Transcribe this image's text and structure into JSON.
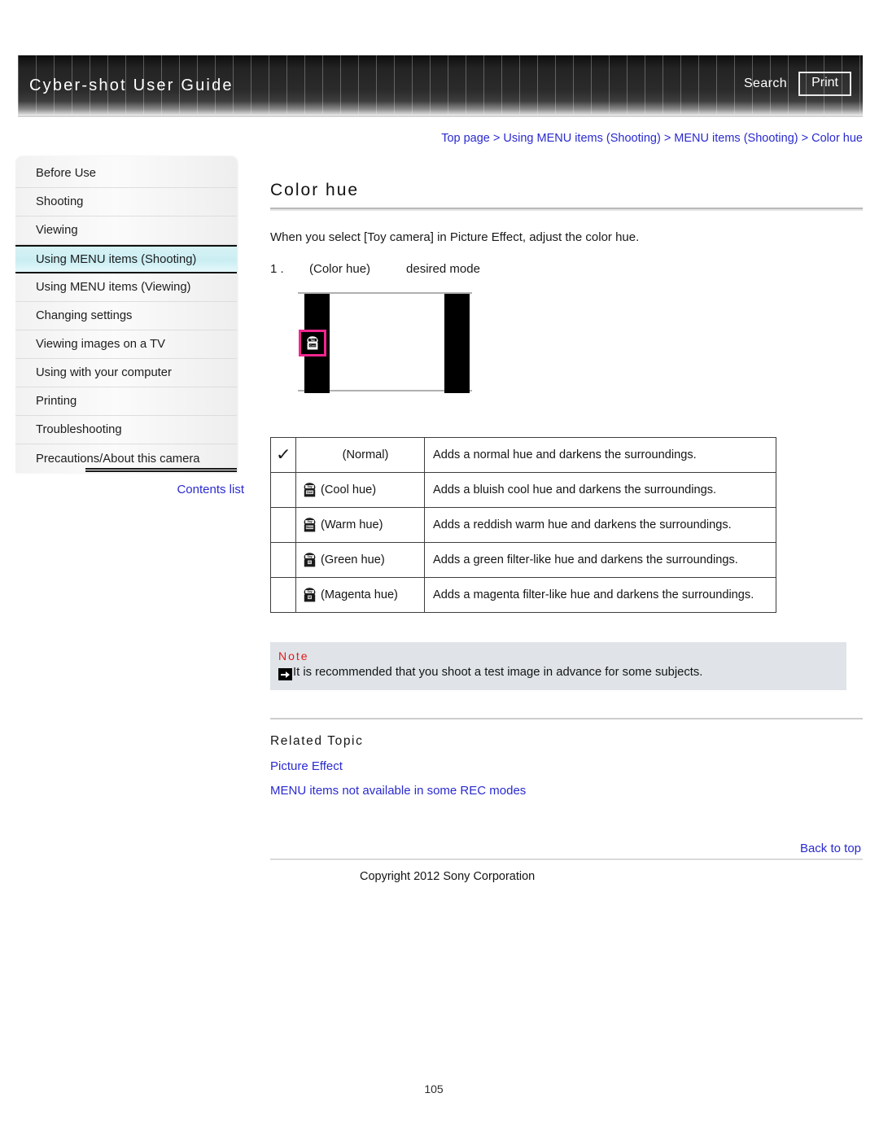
{
  "header": {
    "title": "Cyber-shot User Guide",
    "search_label": "Search",
    "print_label": "Print"
  },
  "breadcrumb": {
    "text": "Top page > Using MENU items (Shooting) > MENU items (Shooting) > Color hue"
  },
  "sidebar": {
    "items": [
      {
        "label": "Before Use",
        "active": false
      },
      {
        "label": "Shooting",
        "active": false
      },
      {
        "label": "Viewing",
        "active": false
      },
      {
        "label": "Using MENU items (Shooting)",
        "active": true
      },
      {
        "label": "Using MENU items (Viewing)",
        "active": false
      },
      {
        "label": "Changing settings",
        "active": false
      },
      {
        "label": "Viewing images on a TV",
        "active": false
      },
      {
        "label": "Using with your computer",
        "active": false
      },
      {
        "label": "Printing",
        "active": false
      },
      {
        "label": "Troubleshooting",
        "active": false
      },
      {
        "label": "Precautions/About this camera",
        "active": false
      }
    ],
    "contents_list_label": "Contents list"
  },
  "main": {
    "title": "Color hue",
    "intro": "When you select [Toy camera] in Picture Effect, adjust the color hue.",
    "step": {
      "number": "1 .",
      "param": "(Color hue)",
      "action": "desired mode"
    },
    "illustration": {
      "icon_name": "toy-camera-icon",
      "highlight_color": "#f2268f"
    },
    "table": {
      "rows": [
        {
          "checked": true,
          "check_glyph": "✓",
          "icon": "",
          "mode": "(Normal)",
          "description": "Adds a normal hue and darkens the surroundings."
        },
        {
          "checked": false,
          "check_glyph": "",
          "icon": "toy-cool-icon",
          "icon_top": "Toy",
          "icon_bottom": "Cool",
          "mode": "(Cool hue)",
          "description": "Adds a bluish cool hue and darkens the surroundings."
        },
        {
          "checked": false,
          "check_glyph": "",
          "icon": "toy-warm-icon",
          "icon_top": "Toy",
          "icon_bottom": "Warm",
          "mode": "(Warm hue)",
          "description": "Adds a reddish warm hue and darkens the surroundings."
        },
        {
          "checked": false,
          "check_glyph": "",
          "icon": "toy-green-icon",
          "icon_top": "Toy",
          "icon_bottom": "G",
          "mode": "(Green hue)",
          "description": "Adds a green filter-like hue and darkens the surroundings."
        },
        {
          "checked": false,
          "check_glyph": "",
          "icon": "toy-magenta-icon",
          "icon_top": "Toy",
          "icon_bottom": "M",
          "mode": "(Magenta hue)",
          "description": "Adds a magenta filter-like hue and darkens the surroundings."
        }
      ]
    },
    "note": {
      "label": "Note",
      "text": "It is recommended that you shoot a test image in advance for some subjects."
    },
    "related": {
      "heading": "Related Topic",
      "links": [
        "Picture Effect",
        "MENU items not available in some REC modes"
      ]
    }
  },
  "footer": {
    "back_to_top": "Back to top",
    "copyright": "Copyright 2012 Sony Corporation",
    "page_number": "105"
  }
}
